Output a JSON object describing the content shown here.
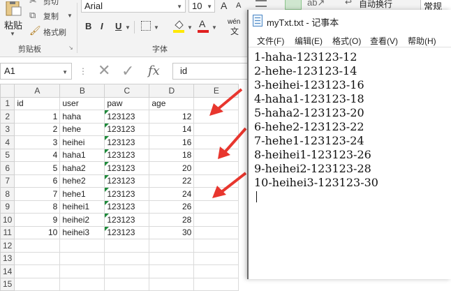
{
  "ribbon": {
    "paste_label": "粘贴",
    "cut_label": "剪切",
    "copy_label": "复制",
    "format_painter_label": "格式刷",
    "font_name": "Arial",
    "font_size": "10",
    "font_grow": "A",
    "font_shrink": "A",
    "bold": "B",
    "italic": "I",
    "underline": "U",
    "font_color": "A",
    "wen": "wén",
    "wrap_text_label": "自动换行",
    "number_format": "常规",
    "clipboard_group": "剪贴板",
    "font_group": "字体"
  },
  "formula_bar": {
    "name_box": "A1",
    "fx_label": "fx",
    "value": "id"
  },
  "sheet": {
    "columns": [
      "A",
      "B",
      "C",
      "D",
      "E"
    ],
    "rows": [
      {
        "n": "1",
        "a": "id",
        "b": "user",
        "c": "paw",
        "d": "age"
      },
      {
        "n": "2",
        "a": "1",
        "b": "haha",
        "c": "123123",
        "d": "12"
      },
      {
        "n": "3",
        "a": "2",
        "b": "hehe",
        "c": "123123",
        "d": "14"
      },
      {
        "n": "4",
        "a": "3",
        "b": "heihei",
        "c": "123123",
        "d": "16"
      },
      {
        "n": "5",
        "a": "4",
        "b": "haha1",
        "c": "123123",
        "d": "18"
      },
      {
        "n": "6",
        "a": "5",
        "b": "haha2",
        "c": "123123",
        "d": "20"
      },
      {
        "n": "7",
        "a": "6",
        "b": "hehe2",
        "c": "123123",
        "d": "22"
      },
      {
        "n": "8",
        "a": "7",
        "b": "hehe1",
        "c": "123123",
        "d": "24"
      },
      {
        "n": "9",
        "a": "8",
        "b": "heihei1",
        "c": "123123",
        "d": "26"
      },
      {
        "n": "10",
        "a": "9",
        "b": "heihei2",
        "c": "123123",
        "d": "28"
      },
      {
        "n": "11",
        "a": "10",
        "b": "heihei3",
        "c": "123123",
        "d": "30"
      },
      {
        "n": "12",
        "a": "",
        "b": "",
        "c": "",
        "d": ""
      },
      {
        "n": "13",
        "a": "",
        "b": "",
        "c": "",
        "d": ""
      },
      {
        "n": "14",
        "a": "",
        "b": "",
        "c": "",
        "d": ""
      },
      {
        "n": "15",
        "a": "",
        "b": "",
        "c": "",
        "d": ""
      }
    ]
  },
  "notepad": {
    "title": "myTxt.txt - 记事本",
    "menu": [
      "文件(F)",
      "编辑(E)",
      "格式(O)",
      "查看(V)",
      "帮助(H)"
    ],
    "lines": [
      "1-haha-123123-12",
      "2-hehe-123123-14",
      "3-heihei-123123-16",
      "4-haha1-123123-18",
      "5-haha2-123123-20",
      "6-hehe2-123123-22",
      "7-hehe1-123123-24",
      "8-heihei1-123123-26",
      "9-heihei2-123123-28",
      "10-heihei3-123123-30"
    ]
  },
  "colors": {
    "arrow": "#e8362e",
    "font_color_bar": "#e02020",
    "highlight_bar": "#ffe800",
    "green_indicator": "#1e8a3a"
  }
}
